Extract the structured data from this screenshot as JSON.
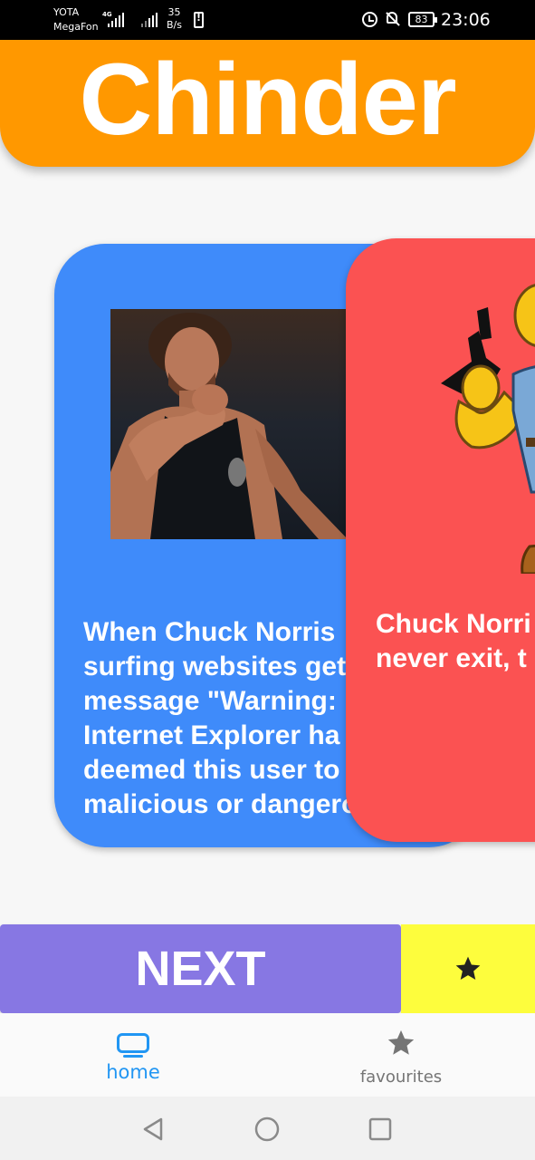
{
  "status_bar": {
    "carrier_top": "YOTA",
    "carrier_bottom": "MegaFon",
    "network_type": "4G",
    "speed_value": "35",
    "speed_unit": "B/s",
    "battery": "83",
    "time": "23:06"
  },
  "header": {
    "title": "Chinder",
    "color": "#ff9800"
  },
  "cards": [
    {
      "color": "#3f8bfa",
      "image": "chuck-norris-photo",
      "text": "When Chuck Norris \nsurfing websites get\nmessage \"Warning: \nInternet Explorer ha\ndeemed this user to\nmalicious or dangero"
    },
    {
      "color": "#fb5252",
      "image": "cartoon-gunman",
      "text": "Chuck Norri\nnever exit, t"
    }
  ],
  "actions": {
    "next_label": "NEXT",
    "next_color": "#8777e3",
    "favourite_icon": "star-icon",
    "favourite_color": "#fdfd3d"
  },
  "bottom_nav": {
    "items": [
      {
        "label": "home",
        "icon": "tv-icon",
        "active": true
      },
      {
        "label": "favourites",
        "icon": "star-icon",
        "active": false
      }
    ]
  },
  "system_nav": [
    "back-icon",
    "home-circle-icon",
    "recents-icon"
  ]
}
